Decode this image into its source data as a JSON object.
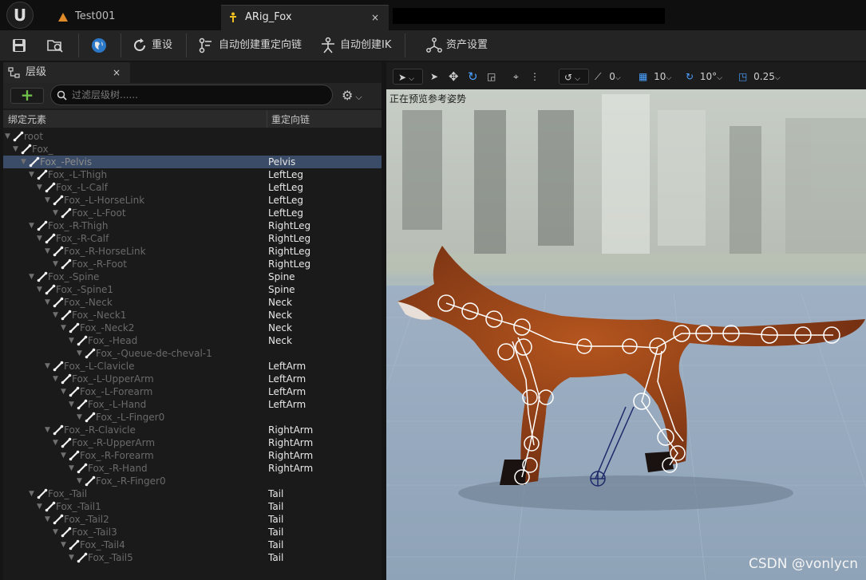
{
  "tabs": [
    {
      "label": "Test001"
    },
    {
      "label": "ARig_Fox",
      "active": true
    }
  ],
  "close_glyph": "×",
  "toolbar": {
    "reset": "重设",
    "auto_chain": "自动创建重定向链",
    "auto_ik": "自动创建IK",
    "asset_settings": "资产设置"
  },
  "panel": {
    "tab_label": "层级",
    "add_glyph": "+",
    "search_placeholder": "过滤层级树......",
    "col_bone": "绑定元素",
    "col_chain": "重定向链"
  },
  "tree": [
    {
      "name": "root",
      "depth": 0,
      "chain": ""
    },
    {
      "name": "Fox_",
      "depth": 1,
      "chain": ""
    },
    {
      "name": "Fox_-Pelvis",
      "depth": 2,
      "chain": "Pelvis",
      "selected": true
    },
    {
      "name": "Fox_-L-Thigh",
      "depth": 3,
      "chain": "LeftLeg"
    },
    {
      "name": "Fox_-L-Calf",
      "depth": 4,
      "chain": "LeftLeg"
    },
    {
      "name": "Fox_-L-HorseLink",
      "depth": 5,
      "chain": "LeftLeg"
    },
    {
      "name": "Fox_-L-Foot",
      "depth": 6,
      "chain": "LeftLeg"
    },
    {
      "name": "Fox_-R-Thigh",
      "depth": 3,
      "chain": "RightLeg"
    },
    {
      "name": "Fox_-R-Calf",
      "depth": 4,
      "chain": "RightLeg"
    },
    {
      "name": "Fox_-R-HorseLink",
      "depth": 5,
      "chain": "RightLeg"
    },
    {
      "name": "Fox_-R-Foot",
      "depth": 6,
      "chain": "RightLeg"
    },
    {
      "name": "Fox_-Spine",
      "depth": 3,
      "chain": "Spine"
    },
    {
      "name": "Fox_-Spine1",
      "depth": 4,
      "chain": "Spine"
    },
    {
      "name": "Fox_-Neck",
      "depth": 5,
      "chain": "Neck"
    },
    {
      "name": "Fox_-Neck1",
      "depth": 6,
      "chain": "Neck"
    },
    {
      "name": "Fox_-Neck2",
      "depth": 7,
      "chain": "Neck"
    },
    {
      "name": "Fox_-Head",
      "depth": 8,
      "chain": "Neck"
    },
    {
      "name": "Fox_-Queue-de-cheval-1",
      "depth": 9,
      "chain": ""
    },
    {
      "name": "Fox_-L-Clavicle",
      "depth": 5,
      "chain": "LeftArm"
    },
    {
      "name": "Fox_-L-UpperArm",
      "depth": 6,
      "chain": "LeftArm"
    },
    {
      "name": "Fox_-L-Forearm",
      "depth": 7,
      "chain": "LeftArm"
    },
    {
      "name": "Fox_-L-Hand",
      "depth": 8,
      "chain": "LeftArm"
    },
    {
      "name": "Fox_-L-Finger0",
      "depth": 9,
      "chain": ""
    },
    {
      "name": "Fox_-R-Clavicle",
      "depth": 5,
      "chain": "RightArm"
    },
    {
      "name": "Fox_-R-UpperArm",
      "depth": 6,
      "chain": "RightArm"
    },
    {
      "name": "Fox_-R-Forearm",
      "depth": 7,
      "chain": "RightArm"
    },
    {
      "name": "Fox_-R-Hand",
      "depth": 8,
      "chain": "RightArm"
    },
    {
      "name": "Fox_-R-Finger0",
      "depth": 9,
      "chain": ""
    },
    {
      "name": "Fox_-Tail",
      "depth": 3,
      "chain": "Tail"
    },
    {
      "name": "Fox_-Tail1",
      "depth": 4,
      "chain": "Tail"
    },
    {
      "name": "Fox_-Tail2",
      "depth": 5,
      "chain": "Tail"
    },
    {
      "name": "Fox_-Tail3",
      "depth": 6,
      "chain": "Tail"
    },
    {
      "name": "Fox_-Tail4",
      "depth": 7,
      "chain": "Tail"
    },
    {
      "name": "Fox_-Tail5",
      "depth": 8,
      "chain": "Tail"
    }
  ],
  "viewport": {
    "status": "正在预览参考姿势",
    "rotation_snap": "0",
    "grid_size": "10",
    "angle_snap": "10°",
    "scale_snap": "0.25"
  },
  "watermark": "CSDN @vonlycn",
  "colors": {
    "accent_selected": "#3a4c68",
    "add_green": "#6ec04a",
    "snap_blue": "#4aa0ff"
  }
}
